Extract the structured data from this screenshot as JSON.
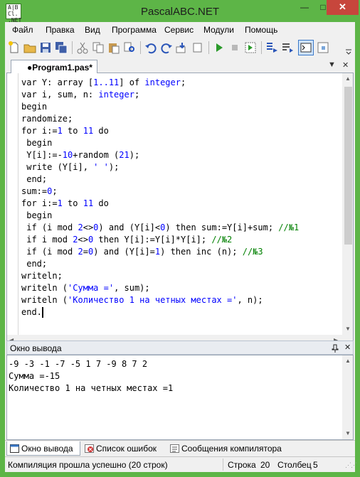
{
  "window": {
    "title": "PascalABC.NET",
    "icon_text": "ABC.NET",
    "min_glyph": "—",
    "max_glyph": "□",
    "close_glyph": "✕"
  },
  "menu": [
    "Файл",
    "Правка",
    "Вид",
    "Программа",
    "Сервис",
    "Модули",
    "Помощь"
  ],
  "toolbar": {
    "buttons": [
      "new-file-icon",
      "open-folder-icon",
      "save-icon",
      "save-all-icon",
      "cut-icon",
      "copy-icon",
      "paste-icon",
      "find-icon",
      "undo-icon",
      "redo-icon",
      "step-into-icon",
      "step-over-icon",
      "run-icon",
      "stop-icon",
      "debug-icon",
      "run-to-cursor-icon",
      "step-out-icon",
      "output-window-icon",
      "form-designer-icon"
    ]
  },
  "editor": {
    "tab_label": "●Program1.pas*",
    "tab_dropdown": "▼",
    "tab_close": "✕",
    "code_lines": [
      [
        {
          "t": "var Y: array [",
          "c": "kw"
        },
        {
          "t": "1..11",
          "c": "num"
        },
        {
          "t": "] of ",
          "c": "kw"
        },
        {
          "t": "integer",
          "c": "ty"
        },
        {
          "t": ";",
          "c": "kw"
        }
      ],
      [
        {
          "t": "var i, sum, n: ",
          "c": "kw"
        },
        {
          "t": "integer",
          "c": "ty"
        },
        {
          "t": ";",
          "c": "kw"
        }
      ],
      [
        {
          "t": "begin",
          "c": "kw"
        }
      ],
      [
        {
          "t": "randomize;",
          "c": "kw"
        }
      ],
      [
        {
          "t": "for i:=",
          "c": "kw"
        },
        {
          "t": "1",
          "c": "num"
        },
        {
          "t": " to ",
          "c": "kw"
        },
        {
          "t": "11",
          "c": "num"
        },
        {
          "t": " do",
          "c": "kw"
        }
      ],
      [
        {
          "t": " begin",
          "c": "kw"
        }
      ],
      [
        {
          "t": " Y[i]:=-",
          "c": "kw"
        },
        {
          "t": "10",
          "c": "num"
        },
        {
          "t": "+random (",
          "c": "kw"
        },
        {
          "t": "21",
          "c": "num"
        },
        {
          "t": ");",
          "c": "kw"
        }
      ],
      [
        {
          "t": " write (Y[i], ",
          "c": "kw"
        },
        {
          "t": "' '",
          "c": "str"
        },
        {
          "t": ");",
          "c": "kw"
        }
      ],
      [
        {
          "t": " end;",
          "c": "kw"
        }
      ],
      [
        {
          "t": "sum:=",
          "c": "kw"
        },
        {
          "t": "0",
          "c": "num"
        },
        {
          "t": ";",
          "c": "kw"
        }
      ],
      [
        {
          "t": "for i:=",
          "c": "kw"
        },
        {
          "t": "1",
          "c": "num"
        },
        {
          "t": " to ",
          "c": "kw"
        },
        {
          "t": "11",
          "c": "num"
        },
        {
          "t": " do",
          "c": "kw"
        }
      ],
      [
        {
          "t": " begin",
          "c": "kw"
        }
      ],
      [
        {
          "t": " if (i mod ",
          "c": "kw"
        },
        {
          "t": "2",
          "c": "num"
        },
        {
          "t": "<>",
          "c": "kw"
        },
        {
          "t": "0",
          "c": "num"
        },
        {
          "t": ") and (Y[i]<",
          "c": "kw"
        },
        {
          "t": "0",
          "c": "num"
        },
        {
          "t": ") then sum:=Y[i]+sum; ",
          "c": "kw"
        },
        {
          "t": "//№1",
          "c": "cm"
        }
      ],
      [
        {
          "t": " if i mod ",
          "c": "kw"
        },
        {
          "t": "2",
          "c": "num"
        },
        {
          "t": "<>",
          "c": "kw"
        },
        {
          "t": "0",
          "c": "num"
        },
        {
          "t": " then Y[i]:=Y[i]*Y[i]; ",
          "c": "kw"
        },
        {
          "t": "//№2",
          "c": "cm"
        }
      ],
      [
        {
          "t": " if (i mod ",
          "c": "kw"
        },
        {
          "t": "2",
          "c": "num"
        },
        {
          "t": "=",
          "c": "kw"
        },
        {
          "t": "0",
          "c": "num"
        },
        {
          "t": ") and (Y[i]=",
          "c": "kw"
        },
        {
          "t": "1",
          "c": "num"
        },
        {
          "t": ") then inc (n); ",
          "c": "kw"
        },
        {
          "t": "//№3",
          "c": "cm"
        }
      ],
      [
        {
          "t": " end;",
          "c": "kw"
        }
      ],
      [
        {
          "t": "writeln;",
          "c": "kw"
        }
      ],
      [
        {
          "t": "writeln (",
          "c": "kw"
        },
        {
          "t": "'Сумма ='",
          "c": "str"
        },
        {
          "t": ", sum);",
          "c": "kw"
        }
      ],
      [
        {
          "t": "writeln (",
          "c": "kw"
        },
        {
          "t": "'Количество 1 на четных местах ='",
          "c": "str"
        },
        {
          "t": ", n);",
          "c": "kw"
        }
      ],
      [
        {
          "t": "end.",
          "c": "kw"
        }
      ]
    ]
  },
  "output_panel": {
    "title": "Окно вывода",
    "pin_glyph": "📌",
    "close_glyph": "✕",
    "lines": [
      "-9 -3 -1 -7 -5 1 7 -9 8 7 2",
      "Сумма =-15",
      "Количество 1 на четных местах =1"
    ]
  },
  "bottom_tabs": [
    "Окно вывода",
    "Список ошибок",
    "Сообщения компилятора"
  ],
  "status": {
    "message": "Компиляция прошла успешно (20 строк)",
    "line_label": "Строка",
    "line_value": "20",
    "col_label": "Столбец",
    "col_value": "5"
  },
  "colors": {
    "frame": "#5db547",
    "close": "#c7463c",
    "keyword": "#000000",
    "type": "#0000ff",
    "comment": "#008000"
  }
}
